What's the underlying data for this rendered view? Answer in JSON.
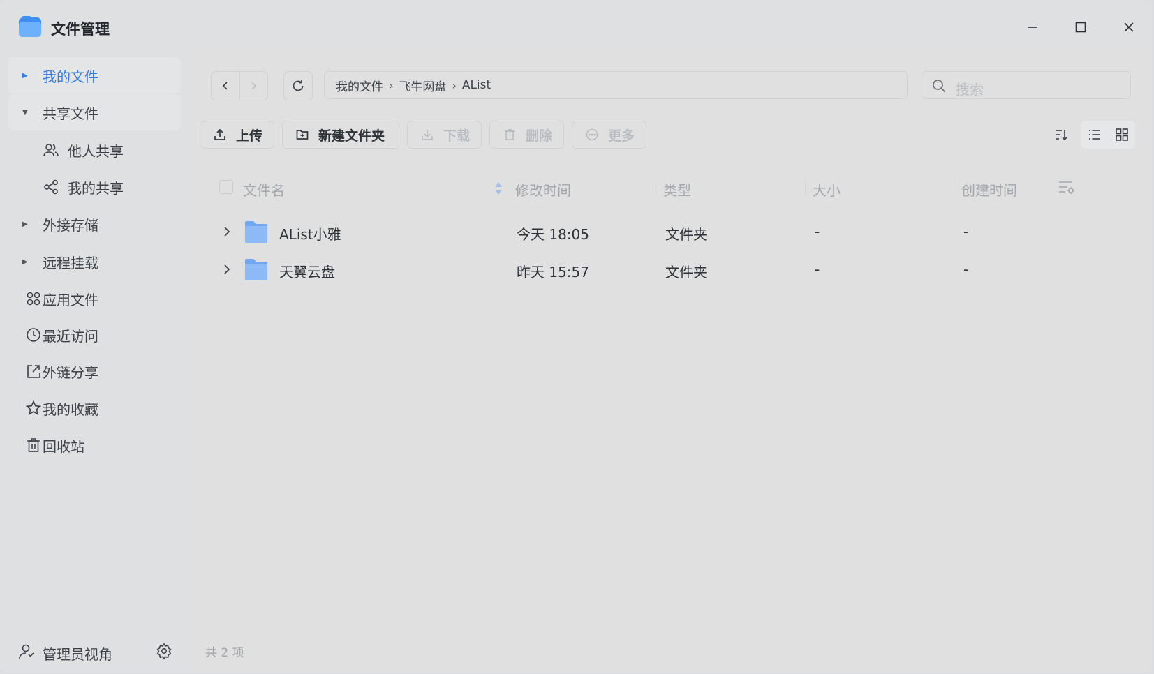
{
  "window": {
    "title": "文件管理"
  },
  "sidebar": {
    "items": [
      {
        "label": "我的文件",
        "active": true,
        "expand": "collapsed"
      },
      {
        "label": "共享文件",
        "expand": "expanded"
      },
      {
        "label": "他人共享",
        "icon": "users-icon"
      },
      {
        "label": "我的共享",
        "icon": "share-nodes-icon"
      },
      {
        "label": "外接存储",
        "expand": "collapsed"
      },
      {
        "label": "远程挂载",
        "expand": "collapsed"
      },
      {
        "label": "应用文件",
        "icon": "apps-grid-icon"
      },
      {
        "label": "最近访问",
        "icon": "clock-icon"
      },
      {
        "label": "外链分享",
        "icon": "external-share-icon"
      },
      {
        "label": "我的收藏",
        "icon": "star-icon"
      },
      {
        "label": "回收站",
        "icon": "trash-icon"
      }
    ],
    "footer": {
      "label": "管理员视角"
    }
  },
  "breadcrumb": [
    "我的文件",
    "飞牛网盘",
    "AList"
  ],
  "search": {
    "placeholder": "搜索"
  },
  "toolbar": {
    "upload": "上传",
    "new_folder": "新建文件夹",
    "download": "下载",
    "delete": "删除",
    "more": "更多"
  },
  "table": {
    "columns": [
      "文件名",
      "修改时间",
      "类型",
      "大小",
      "创建时间"
    ],
    "rows": [
      {
        "name": "AList小雅",
        "modified": "今天 18:05",
        "type": "文件夹",
        "size": "-",
        "created": "-"
      },
      {
        "name": "天翼云盘",
        "modified": "昨天 15:57",
        "type": "文件夹",
        "size": "-",
        "created": "-"
      }
    ]
  },
  "status": {
    "count_text": "共 2 项"
  },
  "colors": {
    "accent": "#2f7ae5",
    "folder": "#7fb2f5"
  }
}
